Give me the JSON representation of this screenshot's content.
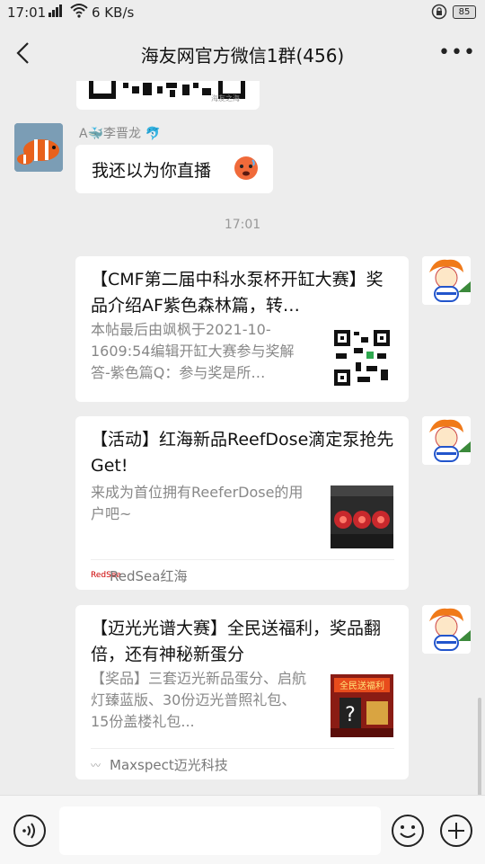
{
  "status_bar": {
    "time": "17:01",
    "signal": "4G",
    "speed": "6 KB/s",
    "battery": "85"
  },
  "header": {
    "title": "海友网官方微信1群(456)",
    "more": "•••"
  },
  "qr_strip_label": "海友之海",
  "message1": {
    "sender": "A🐳李晋龙 🐬",
    "text": "我还以为你直播",
    "emoji": "cold-face-emoji"
  },
  "timestamp": "17:01",
  "cards": [
    {
      "title": "【CMF第二届中科水泵杯开缸大赛】奖品介绍AF紫色森林篇，转…",
      "desc": "本帖最后由飒枫于2021-10-1609:54编辑开缸大赛参与奖解答-紫色篇Q：参与奖是所…",
      "thumb": "qr-code"
    },
    {
      "title": "【活动】红海新品ReefDose滴定泵抢先Get!",
      "desc": "来成为首位拥有ReeferDose的用户吧~",
      "thumb": "reefdose-photo",
      "source": "RedSea红海",
      "source_icon": "RedSea"
    },
    {
      "title": "【迈光光谱大赛】全民送福利，奖品翻倍，还有神秘新蛋分",
      "desc": "【奖品】三套迈光新品蛋分、启航灯臻蓝版、30份迈光普照礼包、15份盖楼礼包...",
      "thumb": "全民送福利",
      "source": "Maxspect迈光科技",
      "source_icon": "〰"
    }
  ],
  "input": {
    "placeholder": ""
  },
  "colors": {
    "bg": "#ededed",
    "bubble": "#ffffff",
    "text_muted": "#888888"
  }
}
